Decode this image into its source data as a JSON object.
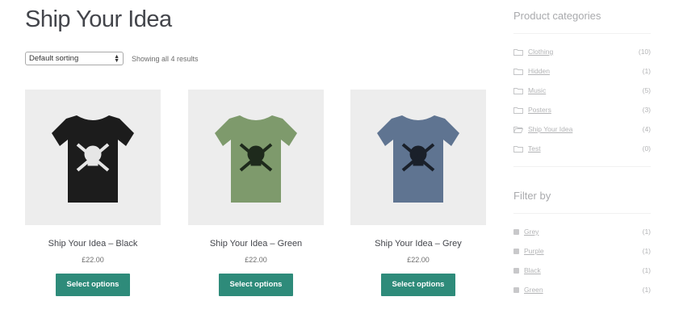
{
  "page": {
    "title": "Ship Your Idea"
  },
  "toolbar": {
    "sorting_value": "Default sorting",
    "result_count": "Showing all 4 results"
  },
  "products": [
    {
      "title": "Ship Your Idea – Black",
      "price": "£22.00",
      "button": "Select options",
      "shirt_color": "#1c1c1c",
      "print_color": "#e6e6e6"
    },
    {
      "title": "Ship Your Idea – Green",
      "price": "£22.00",
      "button": "Select options",
      "shirt_color": "#7e9a6c",
      "print_color": "#1e2a1c"
    },
    {
      "title": "Ship Your Idea – Grey",
      "price": "£22.00",
      "button": "Select options",
      "shirt_color": "#5f7491",
      "print_color": "#1a202a"
    }
  ],
  "sidebar": {
    "categories_title": "Product categories",
    "categories": [
      {
        "label": "Clothing",
        "count": "(10)"
      },
      {
        "label": "Hidden",
        "count": "(1)"
      },
      {
        "label": "Music",
        "count": "(5)"
      },
      {
        "label": "Posters",
        "count": "(3)"
      },
      {
        "label": "Ship Your Idea",
        "count": "(4)"
      },
      {
        "label": "Test",
        "count": "(0)"
      }
    ],
    "filter_title": "Filter by",
    "filters": [
      {
        "label": "Grey",
        "count": "(1)"
      },
      {
        "label": "Purple",
        "count": "(1)"
      },
      {
        "label": "Black",
        "count": "(1)"
      },
      {
        "label": "Green",
        "count": "(1)"
      }
    ]
  },
  "colors": {
    "button": "#2e8b7a",
    "image_bg": "#ededed"
  }
}
